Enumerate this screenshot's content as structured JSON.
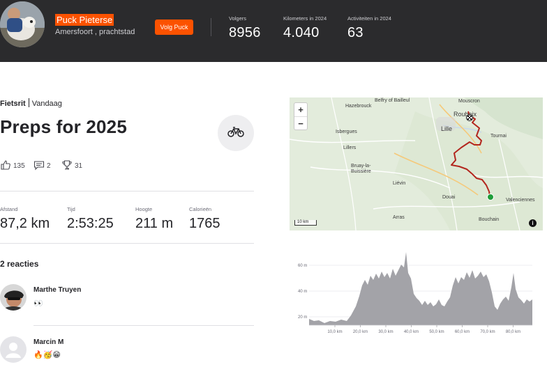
{
  "header": {
    "athlete_name": "Puck Pieterse",
    "location": "Amersfoort , prachtstad",
    "follow_label": "Volg Puck",
    "stats": [
      {
        "label": "Volgers",
        "value": "8956"
      },
      {
        "label": "Kilometers in 2024",
        "value": "4.040"
      },
      {
        "label": "Activiteiten in 2024",
        "value": "63"
      }
    ]
  },
  "activity": {
    "type": "Fietsrit",
    "date": "Vandaag",
    "title": "Preps for 2025",
    "sport_icon": "bike-icon",
    "kudos": "135",
    "comments_count": "2",
    "achievements": "31",
    "metrics": [
      {
        "label": "Afstand",
        "value": "87,2 km"
      },
      {
        "label": "Tijd",
        "value": "2:53:25"
      },
      {
        "label": "Hoogte",
        "value": "211 m"
      },
      {
        "label": "Calorieën",
        "value": "1765"
      }
    ]
  },
  "comments": {
    "title": "2 reacties",
    "items": [
      {
        "name": "Marthe Truyen",
        "text": "👀"
      },
      {
        "name": "Marcin M",
        "text": "🔥🥳😁"
      }
    ]
  },
  "map": {
    "towns": [
      "Mouscron",
      "Hazebrouck",
      "Belfry of Bailleul",
      "Roubaix",
      "Lille",
      "Tournai",
      "Isbergues",
      "Lillers",
      "Bruay-la-Buissière",
      "Liévin",
      "Douai",
      "Valenciennes",
      "Arras",
      "Bouchain"
    ],
    "zoom_in": "+",
    "zoom_out": "−",
    "scale_label": "10 km",
    "info_label": "i",
    "route_color": "#b3261e",
    "start_color": "#1f9d3a"
  },
  "elevation": {
    "y_ticks": [
      "60 m",
      "40 m",
      "20 m"
    ],
    "x_ticks": [
      "10,0 km",
      "20,0 km",
      "30,0 km",
      "40,0 km",
      "50,0 km",
      "60,0 km",
      "70,0 km",
      "80,0 km"
    ]
  },
  "colors": {
    "accent": "#fc5200",
    "header_bg": "#2b2b2d"
  }
}
